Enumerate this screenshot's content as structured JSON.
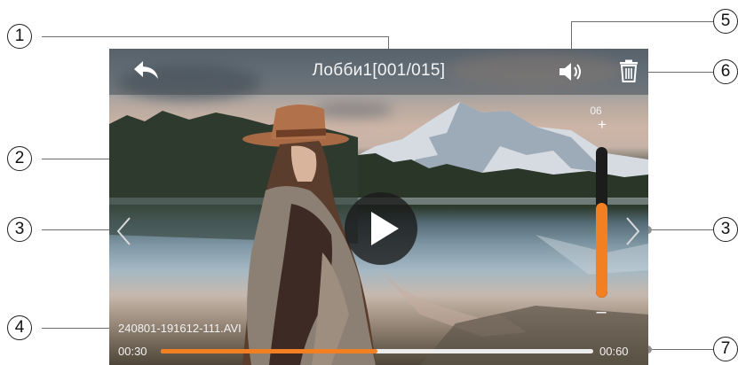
{
  "header": {
    "title": "Лобби1[001/015]"
  },
  "icons": {
    "back": "back-arrow-icon",
    "volume": "speaker-icon",
    "delete": "trash-icon",
    "play": "play-icon",
    "prev": "chevron-left-icon",
    "next": "chevron-right-icon"
  },
  "volume": {
    "level_label": "06",
    "plus": "+",
    "minus": "–",
    "fraction": 0.63
  },
  "file": {
    "name": "240801-191612-111.AVI"
  },
  "playback": {
    "current": "00:30",
    "total": "00:60",
    "progress": 0.5
  },
  "callouts": [
    "1",
    "2",
    "3",
    "3",
    "4",
    "5",
    "6",
    "7"
  ],
  "colors": {
    "accent": "#f27f22",
    "track": "#ececec",
    "volume_track": "#1c1c1c"
  }
}
